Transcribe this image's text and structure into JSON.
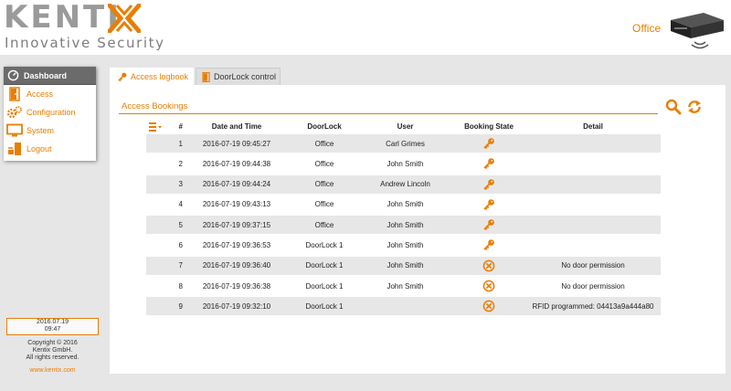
{
  "header": {
    "logo_text": "KENTIX",
    "tagline": "Innovative Security",
    "location": "Office"
  },
  "sidebar": {
    "head_label": "Dashboard",
    "items": [
      {
        "label": "Access",
        "icon": "door-icon"
      },
      {
        "label": "Configuration",
        "icon": "gears-icon"
      },
      {
        "label": "System",
        "icon": "monitor-icon"
      },
      {
        "label": "Logout",
        "icon": "logout-icon"
      }
    ]
  },
  "clock": {
    "date": "2016.07.19",
    "time": "09:47"
  },
  "footer": {
    "copyright_line1": "Copyright © 2016",
    "copyright_line2": "Kentix GmbH.",
    "copyright_line3": "All rights reserved.",
    "website": "www.kentix.com"
  },
  "tabs": [
    {
      "label": "Access logbook",
      "active": true
    },
    {
      "label": "DoorLock control",
      "active": false
    }
  ],
  "section": {
    "title": "Access Bookings"
  },
  "table": {
    "headers": {
      "num": "#",
      "date": "Date and Time",
      "door": "DoorLock",
      "user": "User",
      "state": "Booking State",
      "detail": "Detail"
    },
    "rows": [
      {
        "num": "1",
        "date": "2016-07-19 09:45:27",
        "door": "Office",
        "user": "Carl Grimes",
        "state": "granted",
        "detail": ""
      },
      {
        "num": "2",
        "date": "2016-07-19 09:44:38",
        "door": "Office",
        "user": "John Smith",
        "state": "granted",
        "detail": ""
      },
      {
        "num": "3",
        "date": "2016-07-19 09:44:24",
        "door": "Office",
        "user": "Andrew Lincoln",
        "state": "granted",
        "detail": ""
      },
      {
        "num": "4",
        "date": "2016-07-19 09:43:13",
        "door": "Office",
        "user": "John Smith",
        "state": "granted",
        "detail": ""
      },
      {
        "num": "5",
        "date": "2016-07-19 09:37:15",
        "door": "Office",
        "user": "John Smith",
        "state": "granted",
        "detail": ""
      },
      {
        "num": "6",
        "date": "2016-07-19 09:36:53",
        "door": "DoorLock 1",
        "user": "John Smith",
        "state": "granted",
        "detail": ""
      },
      {
        "num": "7",
        "date": "2016-07-19 09:36:40",
        "door": "DoorLock 1",
        "user": "John Smith",
        "state": "denied",
        "detail": "No door permission"
      },
      {
        "num": "8",
        "date": "2016-07-19 09:36:38",
        "door": "DoorLock 1",
        "user": "John Smith",
        "state": "denied",
        "detail": "No door permission"
      },
      {
        "num": "9",
        "date": "2016-07-19 09:32:10",
        "door": "DoorLock 1",
        "user": "",
        "state": "denied",
        "detail": "RFID programmed: 04413a9a444a80"
      }
    ]
  },
  "colors": {
    "accent": "#e87e04",
    "row_alt": "#e7e7e7",
    "menu_head": "#6b6b6b"
  }
}
